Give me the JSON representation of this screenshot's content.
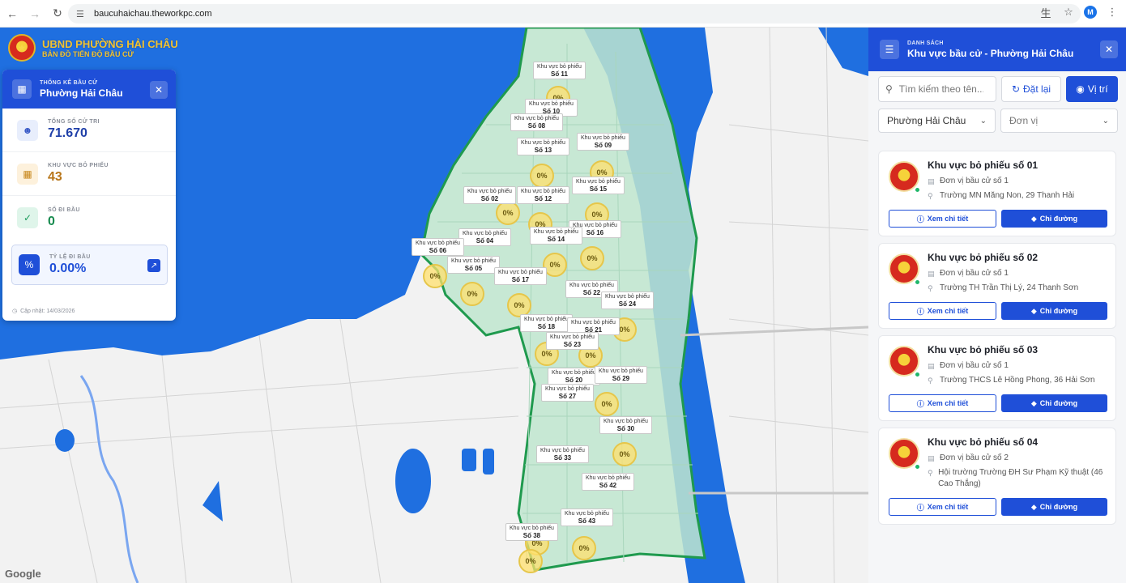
{
  "browser": {
    "url": "baucuhaichau.theworkpc.com",
    "profile_initial": "M"
  },
  "brand": {
    "title": "UBND PHƯỜNG HẢI CHÂU",
    "subtitle": "BẢN ĐỒ TIẾN ĐỘ BẦU CỬ"
  },
  "stats": {
    "header_small": "THỐNG KÊ BẦU CỬ",
    "header_title": "Phường Hải Châu",
    "total_voters_label": "TỔNG SỐ CỬ TRI",
    "total_voters_value": "71.670",
    "areas_label": "KHU VỰC BỎ PHIẾU",
    "areas_value": "43",
    "voted_label": "SỐ ĐI BẦU",
    "voted_value": "0",
    "rate_label": "TỶ LỆ ĐI BẦU",
    "rate_value": "0.00%",
    "updated": "Cập nhật: 14/03/2026"
  },
  "sidebar": {
    "header_small": "DANH SÁCH",
    "header_title": "Khu vực bầu cử - Phường Hải Châu",
    "search_placeholder": "Tìm kiếm theo tên...",
    "reset_label": "Đặt lại",
    "locate_label": "Vị trí",
    "ward_select": "Phường Hải Châu",
    "unit_select": "Đơn vị",
    "detail_label": "Xem chi tiết",
    "directions_label": "Chỉ đường",
    "cards": [
      {
        "title": "Khu vực bỏ phiếu số 01",
        "unit": "Đơn vị bầu cử số 1",
        "address": "Trường MN Măng Non, 29 Thanh Hải"
      },
      {
        "title": "Khu vực bỏ phiếu số 02",
        "unit": "Đơn vị bầu cử số 1",
        "address": "Trường TH Trần Thị Lý, 24 Thanh Sơn"
      },
      {
        "title": "Khu vực bỏ phiếu số 03",
        "unit": "Đơn vị bầu cử số 1",
        "address": "Trường THCS Lê Hồng Phong, 36 Hải Sơn"
      },
      {
        "title": "Khu vực bỏ phiếu số 04",
        "unit": "Đơn vị bầu cử số 2",
        "address": "Hội trường Trường ĐH Sư Phạm Kỹ thuật (46 Cao Thắng)"
      }
    ]
  },
  "map": {
    "label_prefix": "Khu vực bỏ phiếu",
    "pct": "0%",
    "google": "Google",
    "labels": [
      "Số 11",
      "Số 10",
      "Số 08",
      "Số 13",
      "Số 09",
      "Số 15",
      "Số 02",
      "Số 12",
      "Số 16",
      "Số 04",
      "Số 14",
      "Số 06",
      "Số 05",
      "Số 17",
      "Số 22",
      "Số 24",
      "Số 18",
      "Số 21",
      "Số 23",
      "Số 20",
      "Số 29",
      "Số 27",
      "Số 30",
      "Số 33",
      "Số 42",
      "Số 43",
      "Số 38"
    ]
  }
}
